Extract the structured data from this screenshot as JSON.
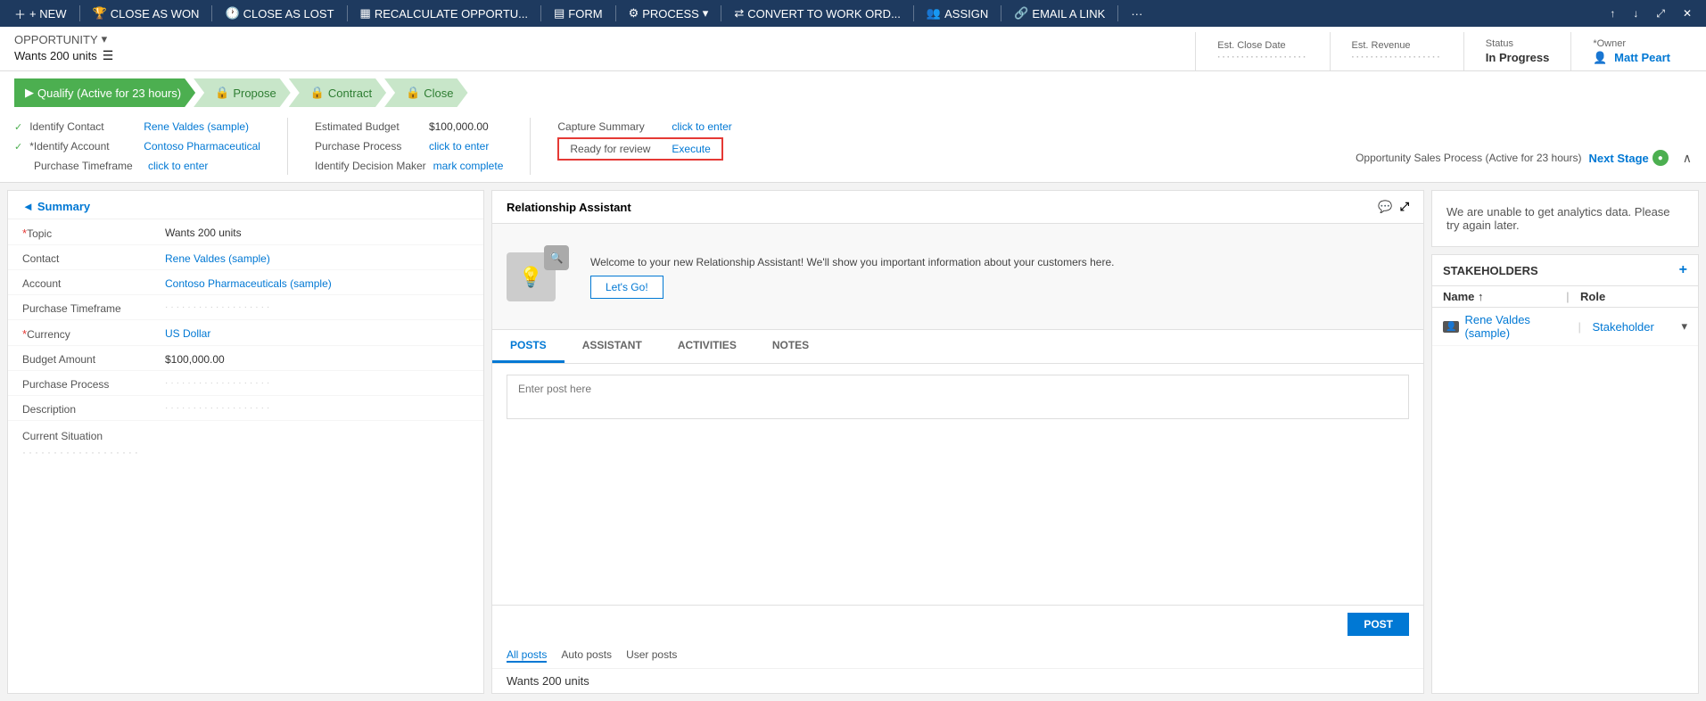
{
  "toolbar": {
    "new_label": "+ NEW",
    "close_as_won_label": "CLOSE AS WON",
    "close_as_lost_label": "CLOSE AS LOST",
    "recalculate_label": "RECALCULATE OPPORTU...",
    "form_label": "FORM",
    "process_label": "PROCESS",
    "convert_label": "CONVERT TO WORK ORD...",
    "assign_label": "ASSIGN",
    "email_label": "EMAIL A LINK",
    "more_label": "···"
  },
  "header": {
    "opp_label": "OPPORTUNITY",
    "title": "Wants 200 units",
    "est_close_date_label": "Est. Close Date",
    "est_close_date_value": "···················",
    "est_revenue_label": "Est. Revenue",
    "est_revenue_value": "···················",
    "status_label": "Status",
    "status_value": "In Progress",
    "owner_label": "*Owner",
    "owner_value": "Matt Peart"
  },
  "stages": {
    "qualify": {
      "label": "Qualify (Active for 23 hours)",
      "state": "active"
    },
    "propose": {
      "label": "Propose",
      "state": "locked"
    },
    "contract": {
      "label": "Contract",
      "state": "locked"
    },
    "close": {
      "label": "Close",
      "state": "locked"
    }
  },
  "stage_details": {
    "col1": {
      "rows": [
        {
          "check": true,
          "label": "Identify Contact",
          "value": "Rene Valdes (sample)",
          "link": true
        },
        {
          "check": true,
          "label": "*Identify Account",
          "value": "Contoso Pharmaceutical",
          "link": true
        },
        {
          "check": false,
          "label": "Purchase Timeframe",
          "value": "click to enter",
          "link": true
        }
      ]
    },
    "col2": {
      "rows": [
        {
          "check": false,
          "label": "Estimated Budget",
          "value": "$100,000.00",
          "link": false
        },
        {
          "check": false,
          "label": "Purchase Process",
          "value": "click to enter",
          "link": true
        },
        {
          "check": false,
          "label": "Identify Decision Maker",
          "value": "mark complete",
          "link": true
        }
      ]
    },
    "col3": {
      "capture_summary_label": "Capture Summary",
      "capture_summary_value": "click to enter",
      "ready_for_review_label": "Ready for review",
      "execute_label": "Execute"
    },
    "next_stage_text": "Opportunity Sales Process (Active for 23 hours)",
    "next_stage_btn": "Next Stage"
  },
  "summary": {
    "section_title": "Summary",
    "fields": [
      {
        "label": "*Topic",
        "value": "Wants 200 units",
        "type": "text"
      },
      {
        "label": "Contact",
        "value": "Rene Valdes (sample)",
        "type": "link"
      },
      {
        "label": "Account",
        "value": "Contoso Pharmaceuticals (sample)",
        "type": "link"
      },
      {
        "label": "Purchase Timeframe",
        "value": "···················",
        "type": "dots"
      },
      {
        "label": "*Currency",
        "value": "US Dollar",
        "type": "link"
      },
      {
        "label": "Budget Amount",
        "value": "$100,000.00",
        "type": "text"
      },
      {
        "label": "Purchase Process",
        "value": "···················",
        "type": "dots"
      },
      {
        "label": "Description",
        "value": "···················",
        "type": "dots"
      }
    ],
    "current_situation_label": "Current Situation",
    "current_situation_value": "···················"
  },
  "relationship_assistant": {
    "title": "Relationship Assistant",
    "welcome_text": "Welcome to your new Relationship Assistant! We'll show you important information about your customers here.",
    "lets_go_label": "Let's Go!"
  },
  "posts_section": {
    "tabs": [
      "POSTS",
      "ASSISTANT",
      "ACTIVITIES",
      "NOTES"
    ],
    "active_tab": "POSTS",
    "post_placeholder": "Enter post here",
    "post_btn_label": "POST",
    "filters": [
      "All posts",
      "Auto posts",
      "User posts"
    ],
    "active_filter": "All posts",
    "preview_text": "Wants 200 units"
  },
  "analytics": {
    "text": "We are unable to get analytics data. Please try again later."
  },
  "stakeholders": {
    "title": "STAKEHOLDERS",
    "add_btn": "+",
    "cols": [
      "Name ↑",
      "Role"
    ],
    "rows": [
      {
        "name": "Rene Valdes (sample)",
        "role": "Stakeholder"
      }
    ]
  }
}
